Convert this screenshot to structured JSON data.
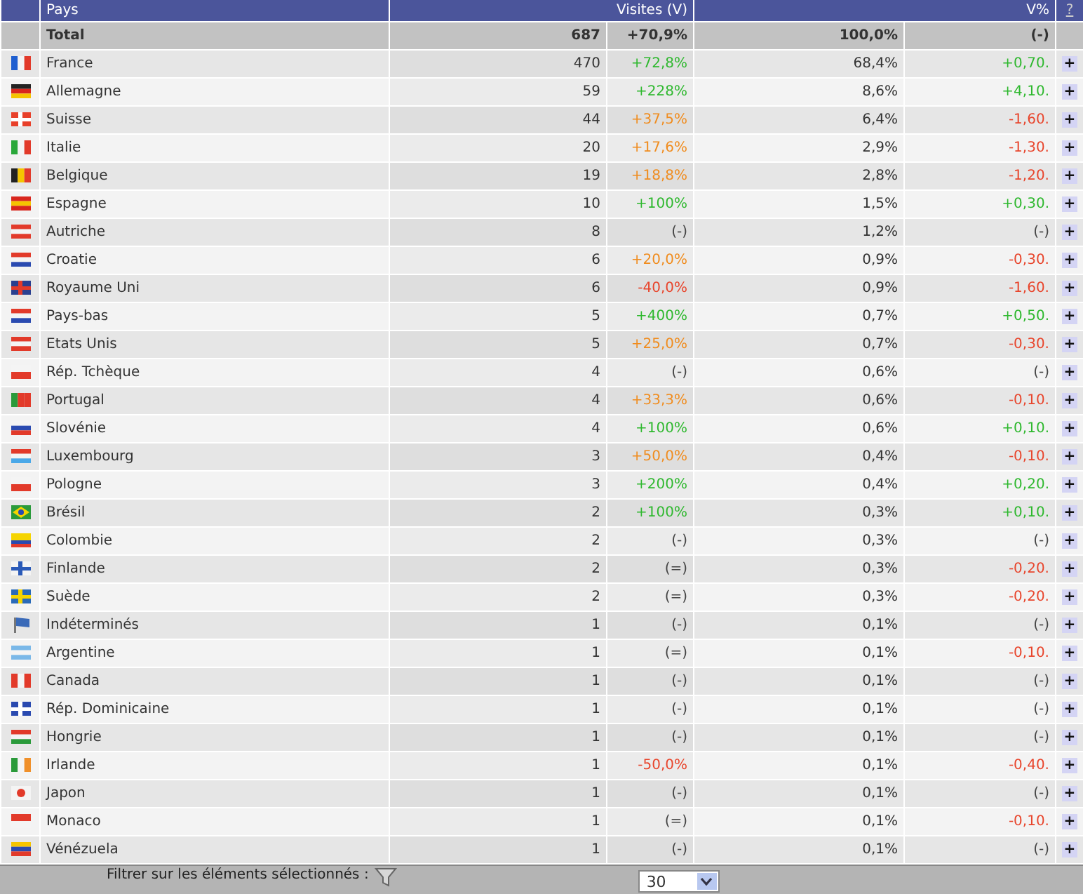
{
  "header": {
    "country": "Pays",
    "visits": "Visites (V)",
    "share": "V%",
    "help": "?"
  },
  "total": {
    "label": "Total",
    "visits": "687",
    "evolution": {
      "text": "+70,9%",
      "color": "#333333"
    },
    "share": "100,0%",
    "share_change": {
      "text": "(-)",
      "color": "#333333"
    }
  },
  "rows": [
    {
      "name": "France",
      "flag": {
        "kind": "v",
        "stripes": [
          {
            "color": "#1f5fd0"
          },
          {
            "color": "#f4f4f4"
          },
          {
            "color": "#e23a2a"
          }
        ]
      },
      "visits": "470",
      "evolution": {
        "text": "+72,8%",
        "color": "#2eb82e"
      },
      "share": "68,4%",
      "share_change": {
        "text": "+0,70.",
        "color": "#2eb82e"
      },
      "action": "+"
    },
    {
      "name": "Allemagne",
      "flag": {
        "kind": "h",
        "stripes": [
          {
            "color": "#222222"
          },
          {
            "color": "#d8261d"
          },
          {
            "color": "#f5c400"
          }
        ]
      },
      "visits": "59",
      "evolution": {
        "text": "+228%",
        "color": "#2eb82e"
      },
      "share": "8,6%",
      "share_change": {
        "text": "+4,10.",
        "color": "#2eb82e"
      },
      "action": "+"
    },
    {
      "name": "Suisse",
      "flag": {
        "kind": "cross",
        "stripes": [
          {
            "color": "#e8402a"
          },
          {
            "color": "#ffffff"
          }
        ]
      },
      "visits": "44",
      "evolution": {
        "text": "+37,5%",
        "color": "#f08c1e"
      },
      "share": "6,4%",
      "share_change": {
        "text": "-1,60.",
        "color": "#e8452c"
      },
      "action": "+"
    },
    {
      "name": "Italie",
      "flag": {
        "kind": "v",
        "stripes": [
          {
            "color": "#2aa83a"
          },
          {
            "color": "#f4f4f4"
          },
          {
            "color": "#e23a2a"
          }
        ]
      },
      "visits": "20",
      "evolution": {
        "text": "+17,6%",
        "color": "#f08c1e"
      },
      "share": "2,9%",
      "share_change": {
        "text": "-1,30.",
        "color": "#e8452c"
      },
      "action": "+"
    },
    {
      "name": "Belgique",
      "flag": {
        "kind": "v",
        "stripes": [
          {
            "color": "#222222"
          },
          {
            "color": "#f5c400"
          },
          {
            "color": "#e23a2a"
          }
        ]
      },
      "visits": "19",
      "evolution": {
        "text": "+18,8%",
        "color": "#f08c1e"
      },
      "share": "2,8%",
      "share_change": {
        "text": "-1,20.",
        "color": "#e8452c"
      },
      "action": "+"
    },
    {
      "name": "Espagne",
      "flag": {
        "kind": "h",
        "stripes": [
          {
            "color": "#d8261d"
          },
          {
            "color": "#f5c400"
          },
          {
            "color": "#d8261d"
          }
        ]
      },
      "visits": "10",
      "evolution": {
        "text": "+100%",
        "color": "#2eb82e"
      },
      "share": "1,5%",
      "share_change": {
        "text": "+0,30.",
        "color": "#2eb82e"
      },
      "action": "+"
    },
    {
      "name": "Autriche",
      "flag": {
        "kind": "h",
        "stripes": [
          {
            "color": "#e23a2a"
          },
          {
            "color": "#f4f4f4"
          },
          {
            "color": "#e23a2a"
          }
        ]
      },
      "visits": "8",
      "evolution": {
        "text": "(-)",
        "color": "#444444"
      },
      "share": "1,2%",
      "share_change": {
        "text": "(-)",
        "color": "#444444"
      },
      "action": "+"
    },
    {
      "name": "Croatie",
      "flag": {
        "kind": "h",
        "stripes": [
          {
            "color": "#e23a2a"
          },
          {
            "color": "#f4f4f4"
          },
          {
            "color": "#2a4ab0"
          }
        ]
      },
      "visits": "6",
      "evolution": {
        "text": "+20,0%",
        "color": "#f08c1e"
      },
      "share": "0,9%",
      "share_change": {
        "text": "-0,30.",
        "color": "#e8452c"
      },
      "action": "+"
    },
    {
      "name": "Royaume Uni",
      "flag": {
        "kind": "cross",
        "stripes": [
          {
            "color": "#2a3f8f"
          },
          {
            "color": "#e23a2a"
          }
        ]
      },
      "visits": "6",
      "evolution": {
        "text": "-40,0%",
        "color": "#e8452c"
      },
      "share": "0,9%",
      "share_change": {
        "text": "-1,60.",
        "color": "#e8452c"
      },
      "action": "+"
    },
    {
      "name": "Pays-bas",
      "flag": {
        "kind": "h",
        "stripes": [
          {
            "color": "#e23a2a"
          },
          {
            "color": "#f4f4f4"
          },
          {
            "color": "#2a4ab0"
          }
        ]
      },
      "visits": "5",
      "evolution": {
        "text": "+400%",
        "color": "#2eb82e"
      },
      "share": "0,7%",
      "share_change": {
        "text": "+0,50.",
        "color": "#2eb82e"
      },
      "action": "+"
    },
    {
      "name": "Etats Unis",
      "flag": {
        "kind": "h",
        "stripes": [
          {
            "color": "#e23a2a"
          },
          {
            "color": "#f4f4f4"
          },
          {
            "color": "#e23a2a"
          }
        ]
      },
      "visits": "5",
      "evolution": {
        "text": "+25,0%",
        "color": "#f08c1e"
      },
      "share": "0,7%",
      "share_change": {
        "text": "-0,30.",
        "color": "#e8452c"
      },
      "action": "+"
    },
    {
      "name": "Rép. Tchèque",
      "flag": {
        "kind": "h",
        "stripes": [
          {
            "color": "#f4f4f4"
          },
          {
            "color": "#e23a2a"
          }
        ]
      },
      "visits": "4",
      "evolution": {
        "text": "(-)",
        "color": "#444444"
      },
      "share": "0,6%",
      "share_change": {
        "text": "(-)",
        "color": "#444444"
      },
      "action": "+"
    },
    {
      "name": "Portugal",
      "flag": {
        "kind": "v",
        "stripes": [
          {
            "color": "#2a9a3a"
          },
          {
            "color": "#e23a2a"
          },
          {
            "color": "#e23a2a"
          }
        ]
      },
      "visits": "4",
      "evolution": {
        "text": "+33,3%",
        "color": "#f08c1e"
      },
      "share": "0,6%",
      "share_change": {
        "text": "-0,10.",
        "color": "#e8452c"
      },
      "action": "+"
    },
    {
      "name": "Slovénie",
      "flag": {
        "kind": "h",
        "stripes": [
          {
            "color": "#f4f4f4"
          },
          {
            "color": "#2a4ab0"
          },
          {
            "color": "#e23a2a"
          }
        ]
      },
      "visits": "4",
      "evolution": {
        "text": "+100%",
        "color": "#2eb82e"
      },
      "share": "0,6%",
      "share_change": {
        "text": "+0,10.",
        "color": "#2eb82e"
      },
      "action": "+"
    },
    {
      "name": "Luxembourg",
      "flag": {
        "kind": "h",
        "stripes": [
          {
            "color": "#e23a2a"
          },
          {
            "color": "#f4f4f4"
          },
          {
            "color": "#4aa8e8"
          }
        ]
      },
      "visits": "3",
      "evolution": {
        "text": "+50,0%",
        "color": "#f08c1e"
      },
      "share": "0,4%",
      "share_change": {
        "text": "-0,10.",
        "color": "#e8452c"
      },
      "action": "+"
    },
    {
      "name": "Pologne",
      "flag": {
        "kind": "h",
        "stripes": [
          {
            "color": "#f4f4f4"
          },
          {
            "color": "#e23a2a"
          }
        ]
      },
      "visits": "3",
      "evolution": {
        "text": "+200%",
        "color": "#2eb82e"
      },
      "share": "0,4%",
      "share_change": {
        "text": "+0,20.",
        "color": "#2eb82e"
      },
      "action": "+"
    },
    {
      "name": "Brésil",
      "flag": {
        "kind": "diamond",
        "stripes": [
          {
            "color": "#2a9a3a"
          },
          {
            "color": "#f5d400"
          }
        ]
      },
      "visits": "2",
      "evolution": {
        "text": "+100%",
        "color": "#2eb82e"
      },
      "share": "0,3%",
      "share_change": {
        "text": "+0,10.",
        "color": "#2eb82e"
      },
      "action": "+"
    },
    {
      "name": "Colombie",
      "flag": {
        "kind": "h",
        "stripes": [
          {
            "color": "#f5d400"
          },
          {
            "color": "#f5d400"
          },
          {
            "color": "#2a4ab0"
          },
          {
            "color": "#e23a2a"
          }
        ]
      },
      "visits": "2",
      "evolution": {
        "text": "(-)",
        "color": "#444444"
      },
      "share": "0,3%",
      "share_change": {
        "text": "(-)",
        "color": "#444444"
      },
      "action": "+"
    },
    {
      "name": "Finlande",
      "flag": {
        "kind": "cross",
        "stripes": [
          {
            "color": "#f4f4f4"
          },
          {
            "color": "#2a5ab8"
          }
        ]
      },
      "visits": "2",
      "evolution": {
        "text": "(=)",
        "color": "#444444"
      },
      "share": "0,3%",
      "share_change": {
        "text": "-0,20.",
        "color": "#e8452c"
      },
      "action": "+"
    },
    {
      "name": "Suède",
      "flag": {
        "kind": "cross",
        "stripes": [
          {
            "color": "#2a6ab8"
          },
          {
            "color": "#f5d400"
          }
        ]
      },
      "visits": "2",
      "evolution": {
        "text": "(=)",
        "color": "#444444"
      },
      "share": "0,3%",
      "share_change": {
        "text": "-0,20.",
        "color": "#e8452c"
      },
      "action": "+"
    },
    {
      "name": "Indéterminés",
      "flag": {
        "kind": "pennant",
        "stripes": [
          {
            "color": "#3a6ab8"
          }
        ]
      },
      "visits": "1",
      "evolution": {
        "text": "(-)",
        "color": "#444444"
      },
      "share": "0,1%",
      "share_change": {
        "text": "(-)",
        "color": "#444444"
      },
      "action": "+"
    },
    {
      "name": "Argentine",
      "flag": {
        "kind": "h",
        "stripes": [
          {
            "color": "#7ab8e8"
          },
          {
            "color": "#f4f4f4"
          },
          {
            "color": "#7ab8e8"
          }
        ]
      },
      "visits": "1",
      "evolution": {
        "text": "(=)",
        "color": "#444444"
      },
      "share": "0,1%",
      "share_change": {
        "text": "-0,10.",
        "color": "#e8452c"
      },
      "action": "+"
    },
    {
      "name": "Canada",
      "flag": {
        "kind": "v",
        "stripes": [
          {
            "color": "#e23a2a"
          },
          {
            "color": "#f4f4f4"
          },
          {
            "color": "#e23a2a"
          }
        ]
      },
      "visits": "1",
      "evolution": {
        "text": "(-)",
        "color": "#444444"
      },
      "share": "0,1%",
      "share_change": {
        "text": "(-)",
        "color": "#444444"
      },
      "action": "+"
    },
    {
      "name": "Rép. Dominicaine",
      "flag": {
        "kind": "cross",
        "stripes": [
          {
            "color": "#2a4ab0"
          },
          {
            "color": "#ffffff"
          }
        ]
      },
      "visits": "1",
      "evolution": {
        "text": "(-)",
        "color": "#444444"
      },
      "share": "0,1%",
      "share_change": {
        "text": "(-)",
        "color": "#444444"
      },
      "action": "+"
    },
    {
      "name": "Hongrie",
      "flag": {
        "kind": "h",
        "stripes": [
          {
            "color": "#e23a2a"
          },
          {
            "color": "#f4f4f4"
          },
          {
            "color": "#2a9a3a"
          }
        ]
      },
      "visits": "1",
      "evolution": {
        "text": "(-)",
        "color": "#444444"
      },
      "share": "0,1%",
      "share_change": {
        "text": "(-)",
        "color": "#444444"
      },
      "action": "+"
    },
    {
      "name": "Irlande",
      "flag": {
        "kind": "v",
        "stripes": [
          {
            "color": "#2a9a3a"
          },
          {
            "color": "#f4f4f4"
          },
          {
            "color": "#f0902a"
          }
        ]
      },
      "visits": "1",
      "evolution": {
        "text": "-50,0%",
        "color": "#e8452c"
      },
      "share": "0,1%",
      "share_change": {
        "text": "-0,40.",
        "color": "#e8452c"
      },
      "action": "+"
    },
    {
      "name": "Japon",
      "flag": {
        "kind": "disc",
        "stripes": [
          {
            "color": "#f4f4f4"
          },
          {
            "color": "#e23a2a"
          }
        ]
      },
      "visits": "1",
      "evolution": {
        "text": "(-)",
        "color": "#444444"
      },
      "share": "0,1%",
      "share_change": {
        "text": "(-)",
        "color": "#444444"
      },
      "action": "+"
    },
    {
      "name": "Monaco",
      "flag": {
        "kind": "h",
        "stripes": [
          {
            "color": "#e23a2a"
          },
          {
            "color": "#f4f4f4"
          }
        ]
      },
      "visits": "1",
      "evolution": {
        "text": "(=)",
        "color": "#444444"
      },
      "share": "0,1%",
      "share_change": {
        "text": "-0,10.",
        "color": "#e8452c"
      },
      "action": "+"
    },
    {
      "name": "Vénézuela",
      "flag": {
        "kind": "h",
        "stripes": [
          {
            "color": "#f5c400"
          },
          {
            "color": "#2a4ab0"
          },
          {
            "color": "#e23a2a"
          }
        ]
      },
      "visits": "1",
      "evolution": {
        "text": "(-)",
        "color": "#444444"
      },
      "share": "0,1%",
      "share_change": {
        "text": "(-)",
        "color": "#444444"
      },
      "action": "+"
    }
  ],
  "footer": {
    "filter_label": "Filtrer sur les éléments sélectionnés :",
    "page_size": "30"
  }
}
